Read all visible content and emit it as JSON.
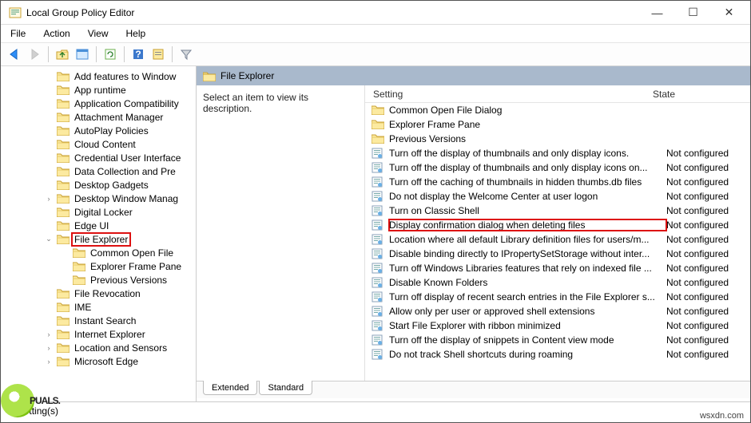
{
  "window": {
    "title": "Local Group Policy Editor"
  },
  "menubar": [
    "File",
    "Action",
    "View",
    "Help"
  ],
  "toolbar_icons": [
    "back-arrow-icon",
    "forward-arrow-icon",
    "up-folder-icon",
    "views-icon",
    "refresh-icon",
    "help-icon",
    "properties-icon",
    "filter-icon"
  ],
  "tree": {
    "indent_base": 70,
    "items": [
      {
        "label": "Add features to Window",
        "indent": 70
      },
      {
        "label": "App runtime",
        "indent": 70
      },
      {
        "label": "Application Compatibility",
        "indent": 70
      },
      {
        "label": "Attachment Manager",
        "indent": 70
      },
      {
        "label": "AutoPlay Policies",
        "indent": 70
      },
      {
        "label": "Cloud Content",
        "indent": 70
      },
      {
        "label": "Credential User Interface",
        "indent": 70
      },
      {
        "label": "Data Collection and Pre",
        "indent": 70
      },
      {
        "label": "Desktop Gadgets",
        "indent": 70
      },
      {
        "label": "Desktop Window Manag",
        "indent": 70,
        "expander": ">"
      },
      {
        "label": "Digital Locker",
        "indent": 70
      },
      {
        "label": "Edge UI",
        "indent": 70
      },
      {
        "label": "File Explorer",
        "indent": 70,
        "expander": "v",
        "highlighted": true
      },
      {
        "label": "Common Open File",
        "indent": 90
      },
      {
        "label": "Explorer Frame Pane",
        "indent": 90
      },
      {
        "label": "Previous Versions",
        "indent": 90
      },
      {
        "label": "File Revocation",
        "indent": 70
      },
      {
        "label": "IME",
        "indent": 70
      },
      {
        "label": "Instant Search",
        "indent": 70
      },
      {
        "label": "Internet Explorer",
        "indent": 70,
        "expander": ">"
      },
      {
        "label": "Location and Sensors",
        "indent": 70,
        "expander": ">"
      },
      {
        "label": "Microsoft Edge",
        "indent": 70,
        "expander": ">"
      }
    ]
  },
  "detail": {
    "header_title": "File Explorer",
    "description_prompt": "Select an item to view its description.",
    "columns": {
      "setting": "Setting",
      "state": "State"
    },
    "rows": [
      {
        "type": "folder",
        "label": "Common Open File Dialog",
        "state": ""
      },
      {
        "type": "folder",
        "label": "Explorer Frame Pane",
        "state": ""
      },
      {
        "type": "folder",
        "label": "Previous Versions",
        "state": ""
      },
      {
        "type": "policy",
        "label": "Turn off the display of thumbnails and only display icons.",
        "state": "Not configured"
      },
      {
        "type": "policy",
        "label": "Turn off the display of thumbnails and only display icons on...",
        "state": "Not configured"
      },
      {
        "type": "policy",
        "label": "Turn off the caching of thumbnails in hidden thumbs.db files",
        "state": "Not configured"
      },
      {
        "type": "policy",
        "label": "Do not display the Welcome Center at user logon",
        "state": "Not configured"
      },
      {
        "type": "policy",
        "label": "Turn on Classic Shell",
        "state": "Not configured"
      },
      {
        "type": "policy",
        "label": "Display confirmation dialog when deleting files",
        "state": "Not configured",
        "highlighted": true
      },
      {
        "type": "policy",
        "label": "Location where all default Library definition files for users/m...",
        "state": "Not configured"
      },
      {
        "type": "policy",
        "label": "Disable binding directly to IPropertySetStorage without inter...",
        "state": "Not configured"
      },
      {
        "type": "policy",
        "label": "Turn off Windows Libraries features that rely on indexed file ...",
        "state": "Not configured"
      },
      {
        "type": "policy",
        "label": "Disable Known Folders",
        "state": "Not configured"
      },
      {
        "type": "policy",
        "label": "Turn off display of recent search entries in the File Explorer s...",
        "state": "Not configured"
      },
      {
        "type": "policy",
        "label": "Allow only per user or approved shell extensions",
        "state": "Not configured"
      },
      {
        "type": "policy",
        "label": "Start File Explorer with ribbon minimized",
        "state": "Not configured"
      },
      {
        "type": "policy",
        "label": "Turn off the display of snippets in Content view mode",
        "state": "Not configured"
      },
      {
        "type": "policy",
        "label": "Do not track Shell shortcuts during roaming",
        "state": "Not configured"
      }
    ]
  },
  "tabs": [
    "Extended",
    "Standard"
  ],
  "statusbar": {
    "text": "47 setting(s)"
  },
  "watermark": "wsxdn.com",
  "brand": "PUALS."
}
